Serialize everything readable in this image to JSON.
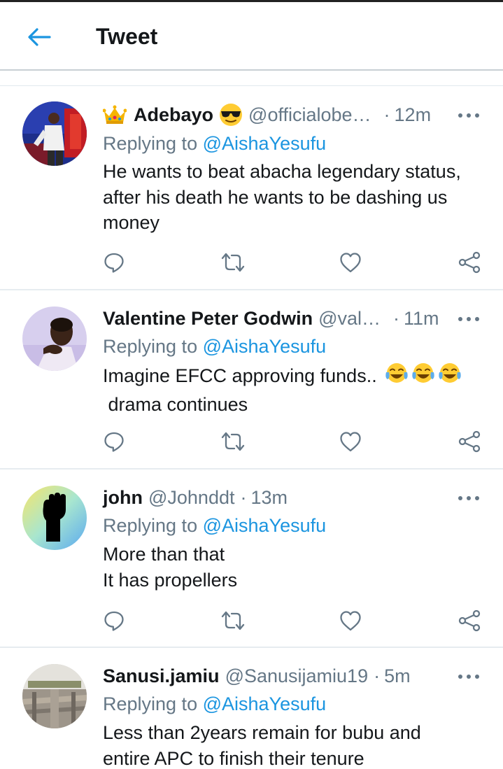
{
  "header": {
    "title": "Tweet"
  },
  "colors": {
    "accent": "#1b95e0",
    "muted": "#657786",
    "text": "#14171a",
    "divider": "#e6ecf0"
  },
  "tweets": [
    {
      "name_prefix_emoji": "crown",
      "name": "Adebayo",
      "name_suffix_emoji": "sunglasses-face",
      "handle": "@officialobe…",
      "sep": "·",
      "time": "12m",
      "replying_prefix": "Replying to",
      "replying_to": "@AishaYesufu",
      "text": "He wants to beat abacha legendary status, after his death he wants to be dashing us money"
    },
    {
      "name": "Valentine Peter Godwin",
      "handle": "@val…",
      "sep": "·",
      "time": "11m",
      "replying_prefix": "Replying to",
      "replying_to": "@AishaYesufu",
      "text_line1": "Imagine EFCC approving funds..",
      "text_emojis": [
        "tears-of-joy",
        "tears-of-joy",
        "tears-of-joy"
      ],
      "text_line2": " drama continues"
    },
    {
      "name": "john",
      "handle": "@Johnddt",
      "sep": "·",
      "time": "13m",
      "replying_prefix": "Replying to",
      "replying_to": "@AishaYesufu",
      "text_line1": "More than that",
      "text_line2": "It has propellers"
    },
    {
      "name": "Sanusi.jamiu",
      "handle": "@Sanusijamiu19",
      "sep": "·",
      "time": "5m",
      "replying_prefix": "Replying to",
      "replying_to": "@AishaYesufu",
      "text": "Less than 2years remain for bubu and entire APC to finish their tenure"
    }
  ],
  "icons": {
    "back": "back-arrow-icon",
    "more": "more-options-icon",
    "reply": "reply-icon",
    "retweet": "retweet-icon",
    "like": "like-icon",
    "share": "share-icon"
  }
}
